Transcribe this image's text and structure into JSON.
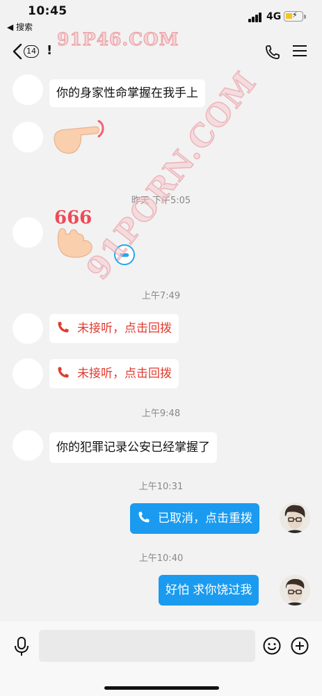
{
  "status_bar": {
    "time": "10:45",
    "back_app": "◀ 搜索",
    "network": "4G"
  },
  "navbar": {
    "unread_count": "14",
    "title": "!",
    "watermark_top": "91P46.COM"
  },
  "watermark_diagonal": "91PORN.COM",
  "messages": [
    {
      "type": "text_in",
      "text": "你的身家性命掌握在我手上"
    },
    {
      "type": "emoji_in",
      "emoji": "pointing-hand-sticker"
    },
    {
      "type": "timestamp",
      "text": "昨天 下午5:05"
    },
    {
      "type": "emoji_in",
      "emoji": "666-hand-sticker",
      "sticker_text": "666"
    },
    {
      "type": "timestamp",
      "text": "上午7:49"
    },
    {
      "type": "call_in",
      "text": "未接听，点击回拨"
    },
    {
      "type": "call_in",
      "text": "未接听，点击回拨"
    },
    {
      "type": "timestamp",
      "text": "上午9:48"
    },
    {
      "type": "text_in",
      "text": "你的犯罪记录公安已经掌握了"
    },
    {
      "type": "timestamp",
      "text": "上午10:31"
    },
    {
      "type": "call_out",
      "text": "已取消，点击重拨"
    },
    {
      "type": "timestamp",
      "text": "上午10:40"
    },
    {
      "type": "text_out",
      "text": "好怕 求你饶过我"
    }
  ],
  "colors": {
    "outgoing_bubble": "#1a9bf0",
    "missed_call": "#e03b2f",
    "background": "#f2f2f2"
  },
  "input_bar": {
    "placeholder": ""
  }
}
